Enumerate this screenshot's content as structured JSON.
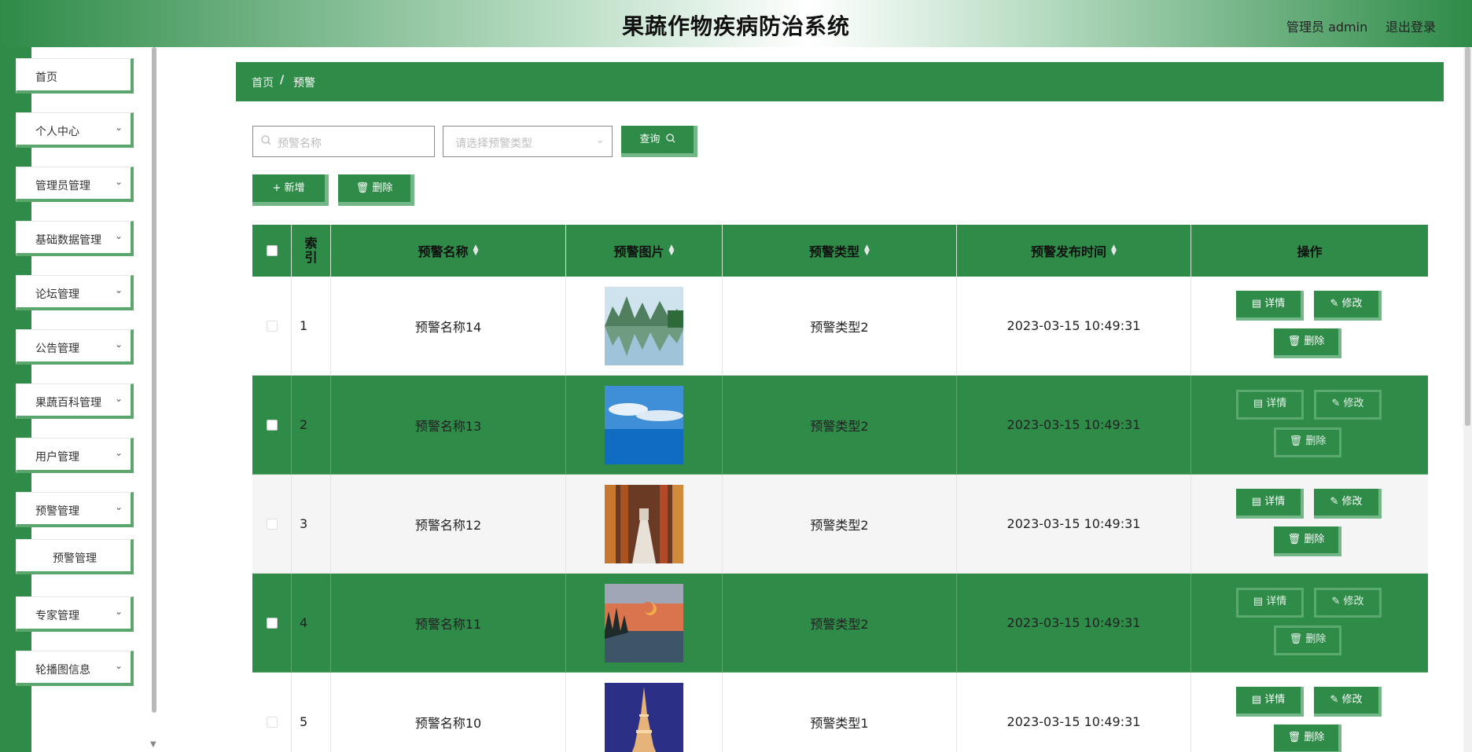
{
  "header": {
    "title": "果蔬作物疾病防治系统",
    "user": "管理员 admin",
    "logout": "退出登录"
  },
  "sidebar": {
    "items": [
      {
        "label": "首页"
      },
      {
        "label": "个人中心"
      },
      {
        "label": "管理员管理"
      },
      {
        "label": "基础数据管理"
      },
      {
        "label": "论坛管理"
      },
      {
        "label": "公告管理"
      },
      {
        "label": "果蔬百科管理"
      },
      {
        "label": "用户管理"
      },
      {
        "label": "预警管理"
      },
      {
        "label": "预警管理"
      },
      {
        "label": "专家管理"
      },
      {
        "label": "轮播图信息"
      }
    ]
  },
  "breadcrumb": {
    "home": "首页",
    "separator": "/",
    "current": "预警"
  },
  "search": {
    "name_placeholder": "预警名称",
    "type_placeholder": "请选择预警类型",
    "query_label": "查询"
  },
  "actions": {
    "add_label": "新增",
    "delete_label": "删除"
  },
  "table": {
    "columns": [
      "索引",
      "预警名称",
      "预警图片",
      "预警类型",
      "预警发布时间",
      "操作"
    ],
    "op_labels": {
      "detail": "详情",
      "edit": "修改",
      "delete": "删除"
    },
    "rows": [
      {
        "index": "1",
        "name": "预警名称14",
        "type": "预警类型2",
        "time": "2023-03-15 10:49:31",
        "image": "mountain-lake"
      },
      {
        "index": "2",
        "name": "预警名称13",
        "type": "预警类型2",
        "time": "2023-03-15 10:49:31",
        "image": "ocean-sky"
      },
      {
        "index": "3",
        "name": "预警名称12",
        "type": "预警类型2",
        "time": "2023-03-15 10:49:31",
        "image": "corridor"
      },
      {
        "index": "4",
        "name": "预警名称11",
        "type": "预警类型2",
        "time": "2023-03-15 10:49:31",
        "image": "moon-sunset"
      },
      {
        "index": "5",
        "name": "预警名称10",
        "type": "预警类型1",
        "time": "2023-03-15 10:49:31",
        "image": "eiffel-tower"
      }
    ]
  },
  "colors": {
    "primary": "#2e8b48",
    "accent_border": "#73b788"
  }
}
